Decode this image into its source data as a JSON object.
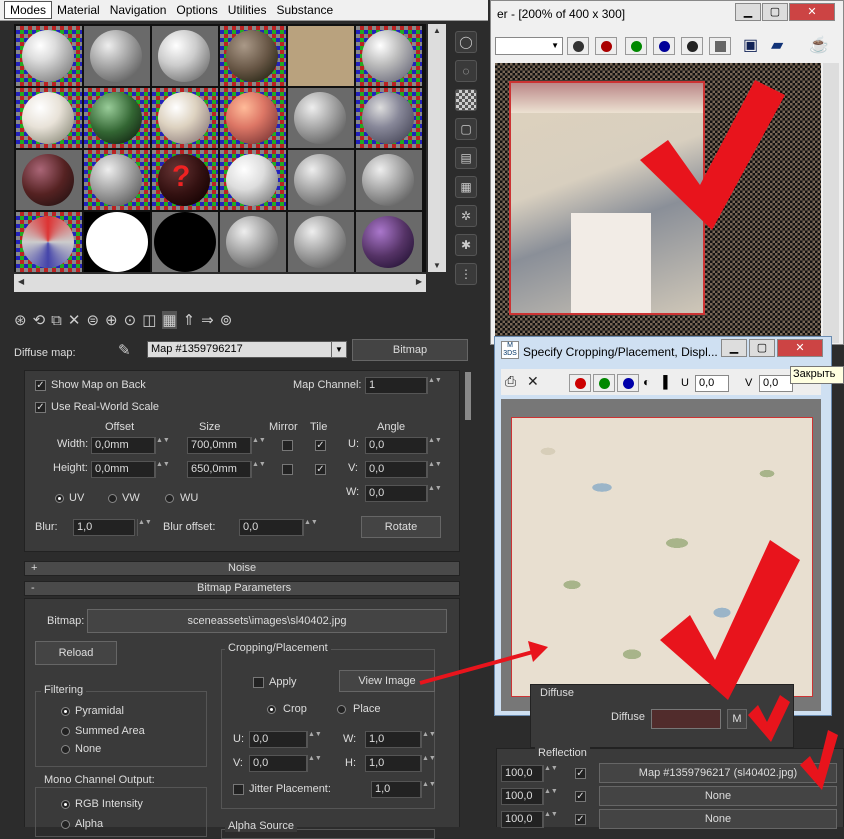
{
  "menu": {
    "items": [
      "Modes",
      "Material",
      "Navigation",
      "Options",
      "Utilities",
      "Substance"
    ]
  },
  "diffuse_row": {
    "label": "Diffuse map:",
    "map_name": "Map #1359796217",
    "type_button": "Bitmap"
  },
  "coordinates": {
    "show_map_on_back": "Show Map on Back",
    "map_channel_label": "Map Channel:",
    "map_channel": "1",
    "real_world_scale": "Use Real-World Scale",
    "offset_label": "Offset",
    "size_label": "Size",
    "mirror_label": "Mirror",
    "tile_label": "Tile",
    "angle_label": "Angle",
    "width_label": "Width:",
    "height_label": "Height:",
    "width_offset": "0,0mm",
    "width_size": "700,0mm",
    "height_offset": "0,0mm",
    "height_size": "650,0mm",
    "u_label": "U:",
    "v_label": "V:",
    "w_label": "W:",
    "angle_u": "0,0",
    "angle_v": "0,0",
    "angle_w": "0,0",
    "uv": "UV",
    "vw": "VW",
    "wu": "WU",
    "blur_label": "Blur:",
    "blur": "1,0",
    "blur_offset_label": "Blur offset:",
    "blur_offset": "0,0",
    "rotate": "Rotate"
  },
  "rollouts": {
    "noise": "Noise",
    "noise_sign": "+",
    "bitmap_params": "Bitmap Parameters",
    "bitmap_sign": "-"
  },
  "bitmap": {
    "bitmap_label": "Bitmap:",
    "path": "sceneassets\\images\\sl40402.jpg",
    "reload": "Reload",
    "cropping_title": "Cropping/Placement",
    "apply": "Apply",
    "view_image": "View Image",
    "crop": "Crop",
    "place": "Place",
    "u_label": "U:",
    "v_label": "V:",
    "w_label": "W:",
    "h_label": "H:",
    "u": "0,0",
    "v": "0,0",
    "w": "1,0",
    "h": "1,0",
    "jitter": "Jitter Placement:",
    "jitter_value": "1,0",
    "filtering_title": "Filtering",
    "pyramidal": "Pyramidal",
    "summed_area": "Summed Area",
    "none": "None",
    "mono_title": "Mono Channel Output:",
    "rgb_intensity": "RGB Intensity",
    "alpha": "Alpha",
    "alpha_source": "Alpha Source"
  },
  "render_window": {
    "title": "er - [200% of 400 x 300]"
  },
  "crop_dialog": {
    "title": "Specify Cropping/Placement, Displ...",
    "icon_text": "M\n3DS",
    "u_label": "U",
    "v_label": "V",
    "u": "0,0",
    "v": "0,0",
    "tooltip": "Закрыть"
  },
  "material_panel": {
    "diffuse_title": "Diffuse",
    "diffuse_label": "Diffuse",
    "m_button": "M",
    "reflection_title": "Reflection",
    "rows": [
      {
        "value": "100,0",
        "map": "Map #1359796217 (sl40402.jpg)"
      },
      {
        "value": "100,0",
        "map": "None"
      },
      {
        "value": "100,0",
        "map": "None"
      }
    ]
  },
  "colors": {
    "red_arrow": "#e8141c",
    "max_bg": "#3a3a3a"
  }
}
